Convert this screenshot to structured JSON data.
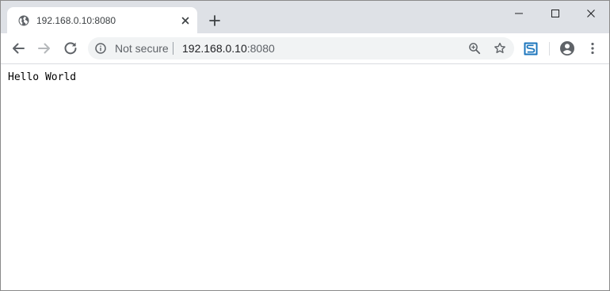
{
  "tab": {
    "title": "192.168.0.10:8080",
    "favicon": "globe-icon",
    "close_icon": "close-icon"
  },
  "new_tab_icon": "plus-icon",
  "window_controls": [
    "minimize-icon",
    "maximize-icon",
    "close-icon"
  ],
  "toolbar": {
    "back_icon": "arrow-left-icon",
    "forward_icon": "arrow-right-icon",
    "reload_icon": "reload-icon"
  },
  "omnibox": {
    "security_icon": "info-icon",
    "security_label": "Not secure",
    "url_host": "192.168.0.10",
    "url_port": ":8080",
    "zoom_icon": "zoom-icon",
    "bookmark_icon": "star-icon"
  },
  "extensions": [
    "s-extension-icon"
  ],
  "profile_icon": "account-circle-icon",
  "menu_icon": "kebab-menu-icon",
  "page": {
    "content": "Hello World"
  },
  "colors": {
    "titlebar": "#dee1e6",
    "omnibox": "#f1f3f4",
    "icon": "#5f6368",
    "extension_accent": "#1b75bc"
  }
}
